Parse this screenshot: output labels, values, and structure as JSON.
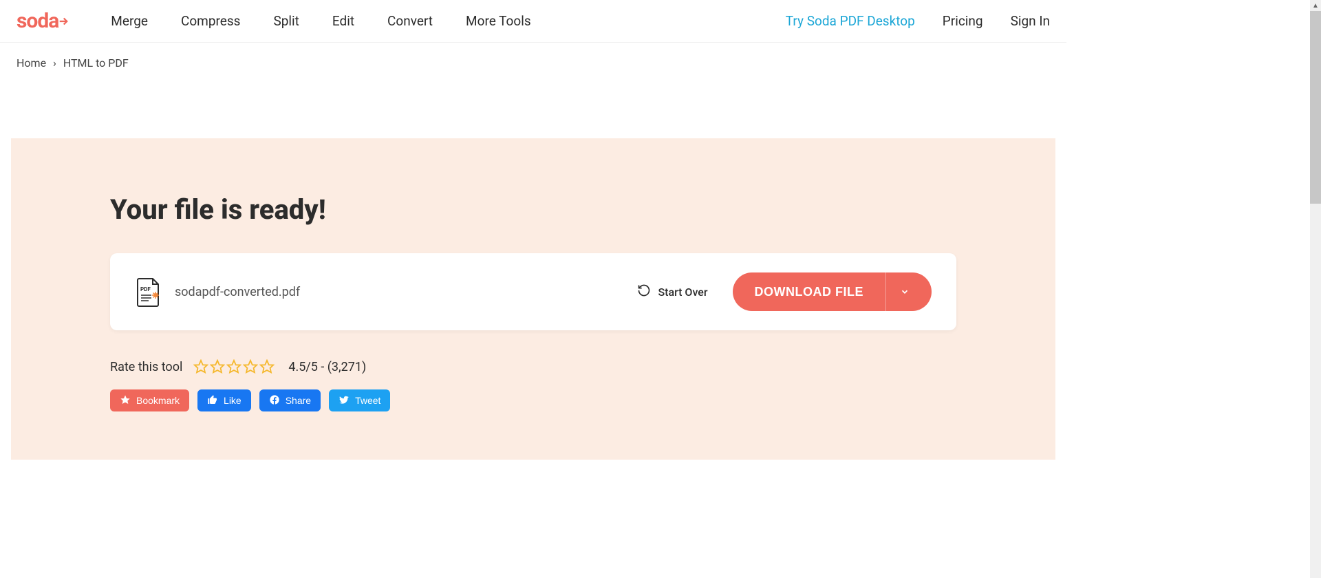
{
  "brand": "soda",
  "nav": {
    "merge": "Merge",
    "compress": "Compress",
    "split": "Split",
    "edit": "Edit",
    "convert": "Convert",
    "more_tools": "More Tools"
  },
  "header_right": {
    "try_desktop": "Try Soda PDF Desktop",
    "pricing": "Pricing",
    "sign_in": "Sign In"
  },
  "breadcrumb": {
    "home": "Home",
    "current": "HTML to PDF"
  },
  "main": {
    "title": "Your file is ready!",
    "filename": "sodapdf-converted.pdf",
    "start_over": "Start Over",
    "download": "DOWNLOAD FILE"
  },
  "rating": {
    "label": "Rate this tool",
    "score": "4.5/5 - (3,271)"
  },
  "share": {
    "bookmark": "Bookmark",
    "like": "Like",
    "share": "Share",
    "tweet": "Tweet"
  }
}
